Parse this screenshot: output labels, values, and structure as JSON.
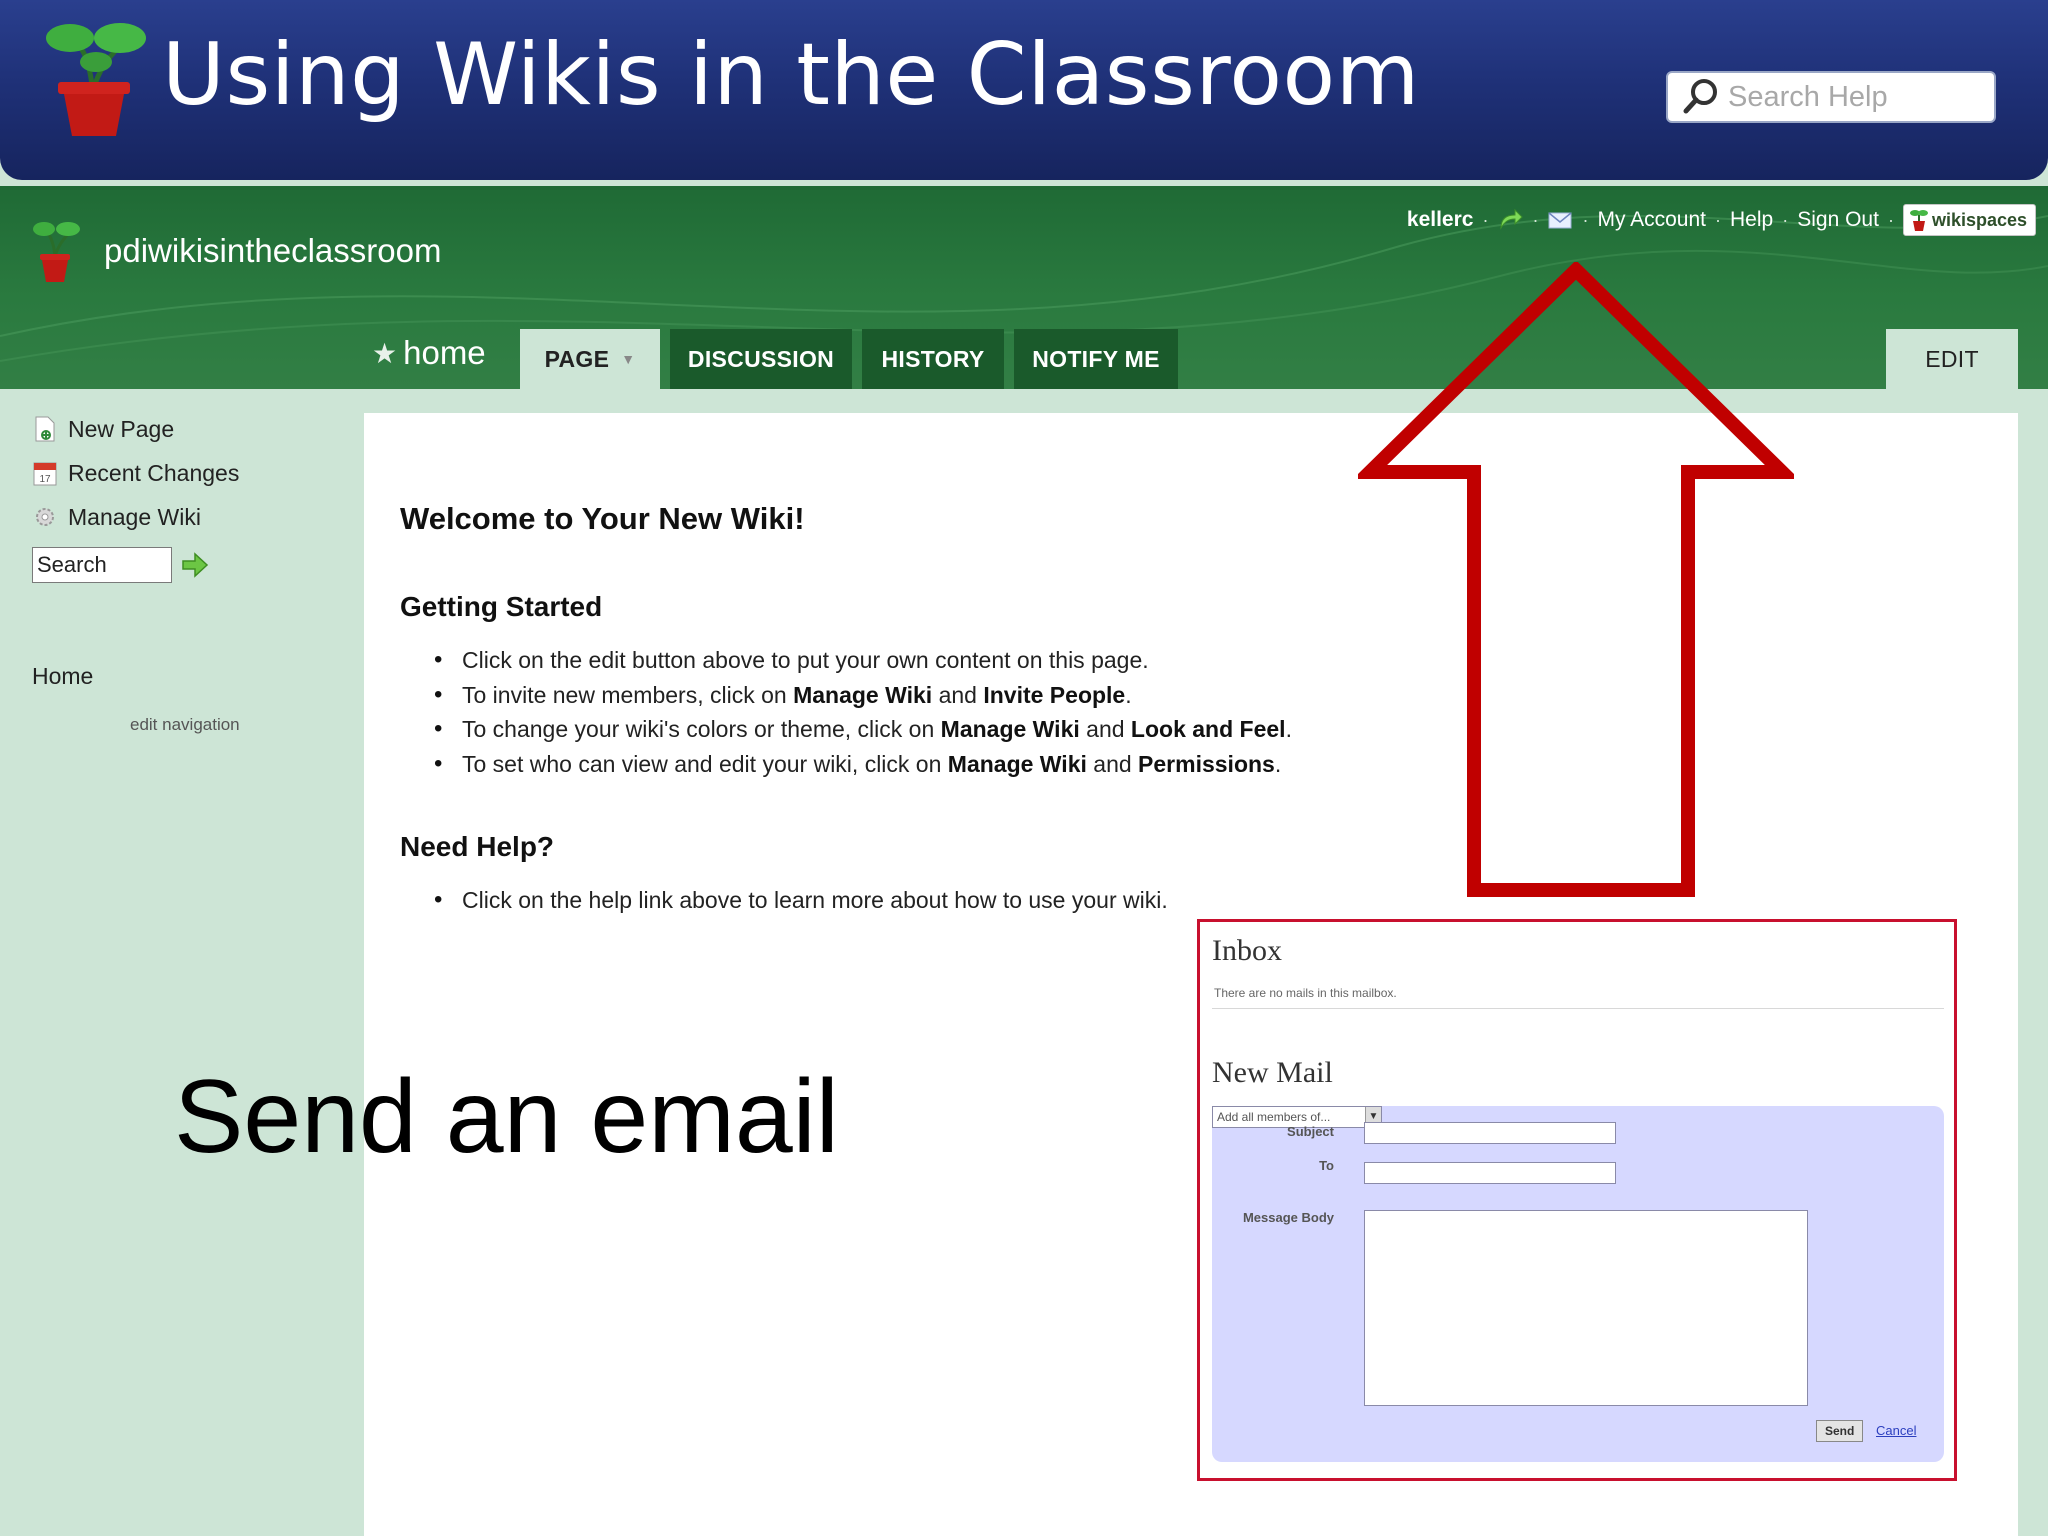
{
  "slide": {
    "title": "Using Wikis in the Classroom",
    "search_placeholder": "Search Help",
    "caption": "Send an email"
  },
  "wiki": {
    "name": "pdiwikisintheclassroom",
    "user_bar": {
      "username": "kellerc",
      "my_account": "My Account",
      "help": "Help",
      "sign_out": "Sign Out",
      "brand": "wikispaces"
    },
    "tabs": {
      "home": "home",
      "page": "PAGE",
      "discussion": "DISCUSSION",
      "history": "HISTORY",
      "notify": "NOTIFY ME",
      "edit": "EDIT"
    },
    "sidebar": {
      "new_page": "New Page",
      "recent_changes": "Recent Changes",
      "manage_wiki": "Manage Wiki",
      "search_value": "Search",
      "nav_home": "Home",
      "edit_navigation": "edit navigation"
    },
    "content": {
      "welcome": "Welcome to Your New Wiki!",
      "getting_started": "Getting Started",
      "getting_started_items": [
        {
          "pre": "Click on the edit button above to put your own content on this page.",
          "b1": "",
          "mid": "",
          "b2": "",
          "post": ""
        },
        {
          "pre": "To invite new members, click on ",
          "b1": "Manage Wiki",
          "mid": " and ",
          "b2": "Invite People",
          "post": "."
        },
        {
          "pre": "To change your wiki's colors or theme, click on ",
          "b1": "Manage Wiki",
          "mid": " and ",
          "b2": "Look and Feel",
          "post": "."
        },
        {
          "pre": "To set who can view and edit your wiki, click on ",
          "b1": "Manage Wiki",
          "mid": " and ",
          "b2": "Permissions",
          "post": "."
        }
      ],
      "need_help": "Need Help?",
      "need_help_items": [
        "Click on the help link above to learn more about how to use your wiki."
      ]
    }
  },
  "mail": {
    "inbox_title": "Inbox",
    "inbox_empty": "There are no mails in this mailbox.",
    "new_mail_title": "New Mail",
    "subject_label": "Subject",
    "to_label": "To",
    "members_select": "Add all members of...",
    "body_label": "Message Body",
    "send": "Send",
    "cancel": "Cancel"
  },
  "colors": {
    "banner_blue": "#1f3178",
    "wiki_green": "#2a7a3f",
    "tab_dark_green": "#1a5a2b",
    "sidebar_mint": "#cde5d6",
    "arrow_red": "#c00000",
    "panel_border": "#c8102e",
    "form_lavender": "#d6d8ff"
  }
}
